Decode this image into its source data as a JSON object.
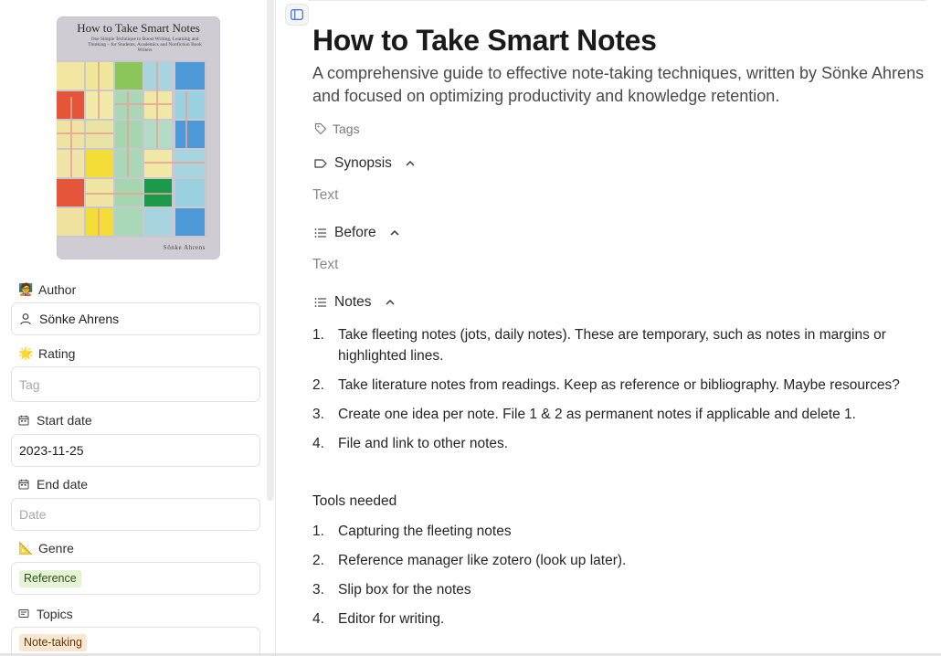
{
  "cover": {
    "title": "How to Take Smart Notes",
    "subtitle": "One Simple Technique to Boost Writing, Learning and Thinking – for Students, Academics and Nonfiction Book Writers",
    "author": "Sönke Ahrens"
  },
  "properties": {
    "author": {
      "label": "Author",
      "icon": "🧑‍🏫",
      "value": "Sönke Ahrens"
    },
    "rating": {
      "label": "Rating",
      "icon": "🌟",
      "placeholder": "Tag"
    },
    "start_date": {
      "label": "Start date",
      "value": "2023-11-25"
    },
    "end_date": {
      "label": "End date",
      "placeholder": "Date"
    },
    "genre": {
      "label": "Genre",
      "icon": "📐",
      "value": "Reference"
    },
    "topics": {
      "label": "Topics",
      "value": "Note-taking"
    }
  },
  "page": {
    "title": "How to Take Smart Notes",
    "subtitle": "A comprehensive guide to effective note-taking techniques, written by Sönke Ahrens and focused on optimizing productivity and knowledge retention.",
    "tags_label": "Tags"
  },
  "sections": {
    "synopsis": {
      "label": "Synopsis",
      "text": "Text"
    },
    "before": {
      "label": "Before",
      "text": "Text"
    },
    "notes": {
      "label": "Notes",
      "items": [
        {
          "num": "1.",
          "text": "Take fleeting notes (jots, daily notes). These are temporary, such as notes in margins or highlighted lines."
        },
        {
          "num": "2.",
          "text": "Take literature notes from readings. Keep as reference or bibliography. Maybe resources?"
        },
        {
          "num": "3.",
          "text": "Create one idea per note. File 1 & 2 as permanent notes if applicable and delete 1."
        },
        {
          "num": "4.",
          "text": "File and link to other notes."
        }
      ],
      "tools_heading": "Tools needed",
      "tools": [
        {
          "num": "1.",
          "text": "Capturing the fleeting notes"
        },
        {
          "num": "2.",
          "text": "Reference manager like zotero (look up later)."
        },
        {
          "num": "3.",
          "text": "Slip box for the notes"
        },
        {
          "num": "4.",
          "text": "Editor for writing."
        }
      ]
    }
  },
  "colors": {
    "accent_green_pill": "#e4f4d5",
    "accent_orange_pill": "#fbe7cf",
    "cover_bg": "#cfcdd3"
  }
}
